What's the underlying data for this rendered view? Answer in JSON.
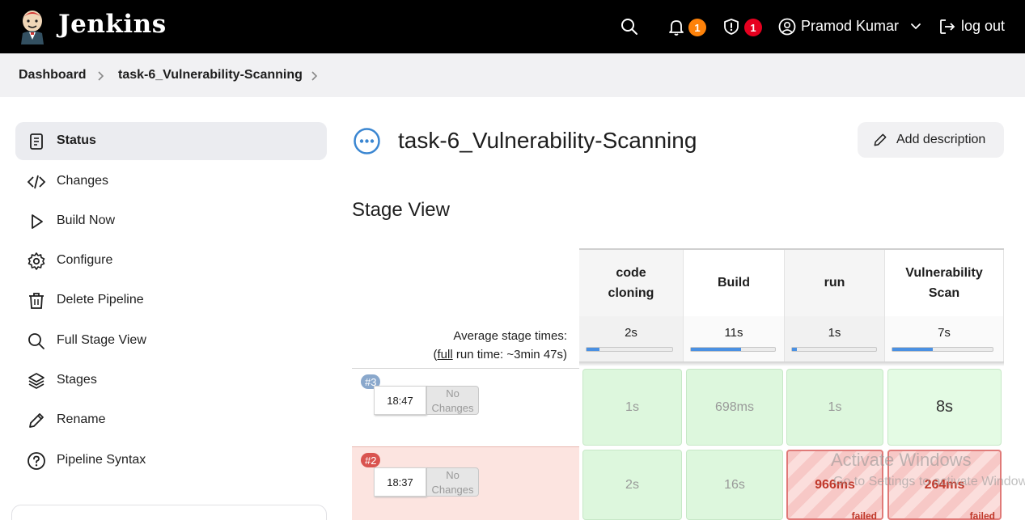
{
  "header": {
    "brand": "Jenkins",
    "notifications_count": "1",
    "security_count": "1",
    "user_name": "Pramod Kumar",
    "logout_label": "log out"
  },
  "breadcrumb": {
    "items": [
      "Dashboard",
      "task-6_Vulnerability-Scanning"
    ]
  },
  "sidebar": {
    "items": [
      {
        "label": "Status",
        "icon": "document-icon",
        "active": true
      },
      {
        "label": "Changes",
        "icon": "code-icon"
      },
      {
        "label": "Build Now",
        "icon": "play-icon"
      },
      {
        "label": "Configure",
        "icon": "gear-icon"
      },
      {
        "label": "Delete Pipeline",
        "icon": "trash-icon"
      },
      {
        "label": "Full Stage View",
        "icon": "search-icon"
      },
      {
        "label": "Stages",
        "icon": "layers-icon"
      },
      {
        "label": "Rename",
        "icon": "pencil-icon"
      },
      {
        "label": "Pipeline Syntax",
        "icon": "help-icon"
      }
    ]
  },
  "main": {
    "job_title": "task-6_Vulnerability-Scanning",
    "add_description": "Add description",
    "stage_view_title": "Stage View",
    "avg_label_line1": "Average stage times:",
    "avg_label_full": "full",
    "avg_label_rest": " run time: ~3min 47s)",
    "avg_label_open": "(",
    "stages": [
      {
        "name_line1": "code",
        "name_line2": "cloning",
        "avg": "2s",
        "bar_fraction": 0.15
      },
      {
        "name_line1": "Build",
        "name_line2": "",
        "avg": "11s",
        "bar_fraction": 0.6
      },
      {
        "name_line1": "run",
        "name_line2": "",
        "avg": "1s",
        "bar_fraction": 0.06
      },
      {
        "name_line1": "Vulnerability",
        "name_line2": "Scan",
        "avg": "7s",
        "bar_fraction": 0.4
      }
    ],
    "runs": [
      {
        "number": "#3",
        "time": "18:47",
        "changes_line1": "No",
        "changes_line2": "Changes",
        "cells": [
          "1s",
          "698ms",
          "1s",
          "8s"
        ]
      },
      {
        "number": "#2",
        "time": "18:37",
        "changes_line1": "No",
        "changes_line2": "Changes",
        "cells": [
          "2s",
          "16s",
          "966ms",
          "264ms"
        ],
        "failed_label": "failed"
      }
    ]
  },
  "watermark": {
    "line1": "Activate Windows",
    "line2": "Go to Settings to activate Windows."
  },
  "colors": {
    "header_bg": "#000000",
    "badge_orange": "#fe820a",
    "badge_red": "#e6001f",
    "success_cell": "#ddf7dd",
    "failed_cell": "#f7c8c6"
  }
}
